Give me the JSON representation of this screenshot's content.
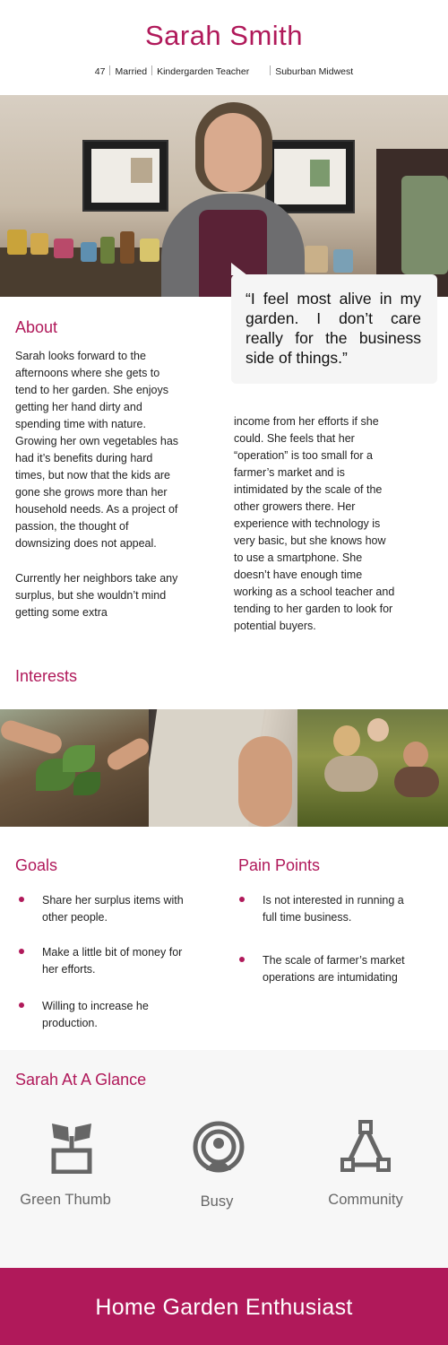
{
  "persona": {
    "name": "Sarah Smith",
    "age": "47",
    "status": "Married",
    "occupation": "Kindergarden Teacher",
    "location": "Suburban Midwest"
  },
  "quote": "“I feel most alive in my garden. I don’t care really for the business side of things.”",
  "about": {
    "title": "About",
    "col1_p1": "Sarah looks forward to the afternoons where she gets to tend to her garden. She enjoys getting her hand dirty and spending time with nature. Growing her own vegetables has had it’s benefits during hard times, but now that the kids are gone she grows more than her household needs. As a project of passion, the thought of downsizing does not appeal.",
    "col1_p2": "Currently her neighbors take any surplus, but she wouldn’t mind getting some extra",
    "col2": "income from her efforts if she could. She feels that her “operation” is too small for a farmer’s market and is intimidated by the scale of the other growers there. Her experience with technology is very basic, but she knows how to use a smartphone. She doesn’t have enough time working as a school teacher and tending to her garden to look for potential buyers."
  },
  "interests": {
    "title": "Interests"
  },
  "goals": {
    "title": "Goals",
    "items": [
      "Share her surplus items with other people.",
      "Make a little bit of money for her efforts.",
      "Willing to increase he production."
    ]
  },
  "pain_points": {
    "title": "Pain Points",
    "items": [
      "Is not interested in running a full time business.",
      "The scale of farmer’s market operations are intumidating"
    ]
  },
  "glance": {
    "title": "Sarah At A Glance",
    "items": [
      {
        "label": "Green Thumb",
        "icon": "plant-pot-icon"
      },
      {
        "label": "Busy",
        "icon": "broadcast-person-icon"
      },
      {
        "label": "Community",
        "icon": "network-triangle-icon"
      }
    ]
  },
  "footer": {
    "title": "Home Garden Enthusiast"
  },
  "colors": {
    "accent": "#b0195a",
    "icon": "#666666",
    "panel": "#f7f7f7"
  }
}
